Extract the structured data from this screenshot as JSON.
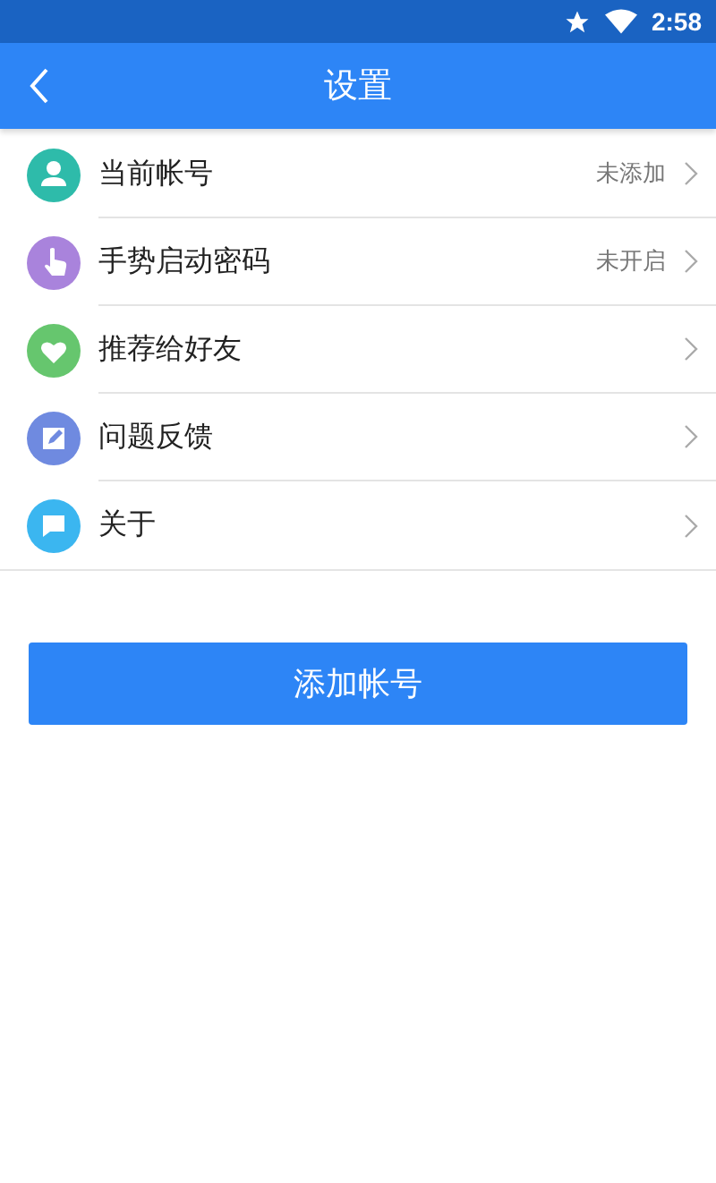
{
  "status_bar": {
    "time": "2:58"
  },
  "app_bar": {
    "title": "设置"
  },
  "items": [
    {
      "kind": "person",
      "label": "当前帐号",
      "value": "未添加",
      "color": "#2ebbaa"
    },
    {
      "kind": "hand",
      "label": "手势启动密码",
      "value": "未开启",
      "color": "#a983dc"
    },
    {
      "kind": "heart",
      "label": "推荐给好友",
      "color": "#66c66e"
    },
    {
      "kind": "edit",
      "label": "问题反馈",
      "color": "#6f8ae0"
    },
    {
      "kind": "chat",
      "label": "关于",
      "color": "#3bb6f0"
    }
  ],
  "button": {
    "label": "添加帐号"
  }
}
